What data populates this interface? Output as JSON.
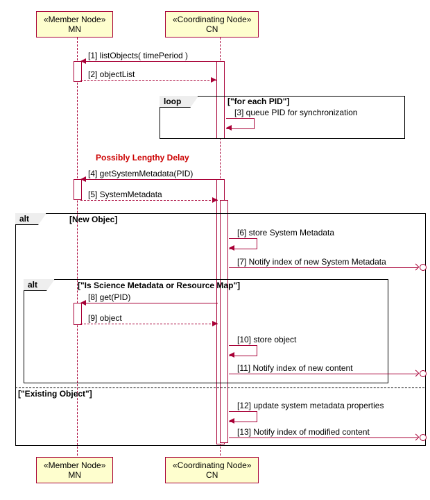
{
  "participants": {
    "mn": {
      "stereotype": "«Member Node»",
      "name": "MN"
    },
    "cn": {
      "stereotype": "«Coordinating Node»",
      "name": "CN"
    }
  },
  "messages": {
    "m1": "[1]  listObjects( timePeriod )",
    "m2": "[2]  objectList",
    "m3": "[3]  queue PID for synchronization",
    "m4": "[4]  getSystemMetadata(PID)",
    "m5": "[5]  SystemMetadata",
    "m6": "[6]  store System Metadata",
    "m7": "[7]  Notify index of new System Metadata",
    "m8": "[8]  get(PID)",
    "m9": "[9]  object",
    "m10": "[10]  store object",
    "m11": "[11]  Notify index of new content",
    "m12": "[12]  update system metadata properties",
    "m13": "[13]  Notify index of modified content"
  },
  "fragments": {
    "loop": {
      "label": "loop",
      "guard": "[\"for each PID\"]"
    },
    "alt_outer": {
      "label": "alt",
      "guard1": "[New Objec]",
      "guard2": "[\"Existing Object\"]"
    },
    "alt_inner": {
      "label": "alt",
      "guard": "[\"Is Science Metadata or Resource Map\"]"
    }
  },
  "delay": "Possibly Lengthy Delay"
}
